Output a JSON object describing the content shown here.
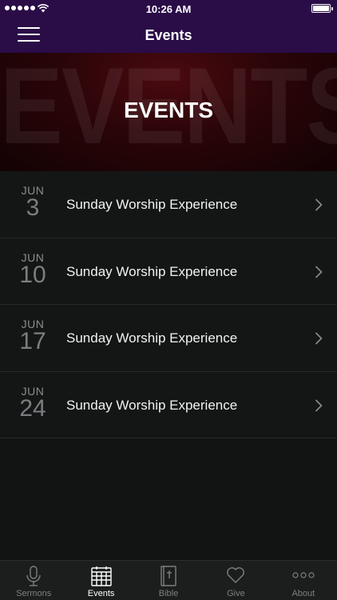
{
  "status": {
    "time": "10:26 AM"
  },
  "navbar": {
    "title": "Events"
  },
  "hero": {
    "bg_text": "EVENTS",
    "title": "EVENTS"
  },
  "events": [
    {
      "month": "JUN",
      "day": "3",
      "title": "Sunday Worship Experience"
    },
    {
      "month": "JUN",
      "day": "10",
      "title": "Sunday Worship Experience"
    },
    {
      "month": "JUN",
      "day": "17",
      "title": "Sunday Worship Experience"
    },
    {
      "month": "JUN",
      "day": "24",
      "title": "Sunday Worship Experience"
    }
  ],
  "tabs": [
    {
      "label": "Sermons",
      "icon": "microphone-icon",
      "active": false
    },
    {
      "label": "Events",
      "icon": "calendar-icon",
      "active": true
    },
    {
      "label": "Bible",
      "icon": "bible-icon",
      "active": false
    },
    {
      "label": "Give",
      "icon": "heart-icon",
      "active": false
    },
    {
      "label": "About",
      "icon": "ellipsis-icon",
      "active": false
    }
  ],
  "colors": {
    "header": "#2a0c47",
    "background": "#121414",
    "tab_active": "#ffffff",
    "tab_inactive": "#7d7f80"
  }
}
